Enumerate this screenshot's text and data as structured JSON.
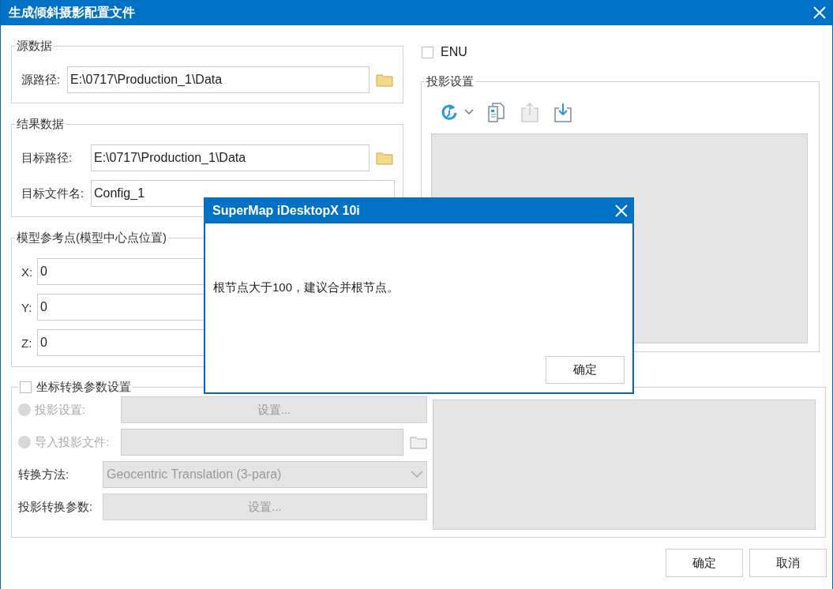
{
  "window": {
    "title": "生成倾斜摄影配置文件"
  },
  "source_group": {
    "title": "源数据",
    "fields": [
      {
        "label": "源路径:",
        "value": "E:\\0717\\Production_1\\Data",
        "browse": true
      }
    ]
  },
  "result_group": {
    "title": "结果数据",
    "fields": [
      {
        "label": "目标路径:",
        "value": "E:\\0717\\Production_1\\Data",
        "browse": true
      },
      {
        "label": "目标文件名:",
        "value": "Config_1",
        "browse": false
      }
    ]
  },
  "reference_group": {
    "title": "模型参考点(模型中心点位置)",
    "fields": [
      {
        "label": "X:",
        "value": "0"
      },
      {
        "label": "Y:",
        "value": "0"
      },
      {
        "label": "Z:",
        "value": "0"
      }
    ]
  },
  "enu": {
    "label": "ENU",
    "checked": false
  },
  "projection_group": {
    "title": "投影设置",
    "toolbar": [
      {
        "kind": "refresh",
        "disabled": false
      },
      {
        "kind": "copy",
        "disabled": false
      },
      {
        "kind": "export",
        "disabled": true
      },
      {
        "kind": "import",
        "disabled": false
      }
    ]
  },
  "transform_group": {
    "title": "坐标转换参数设置",
    "checked": false,
    "rows": [
      {
        "kind": "radio",
        "label": "投影设置:",
        "selected": false,
        "button": "设置..."
      },
      {
        "kind": "file",
        "label": "导入投影文件:",
        "selected": false
      },
      {
        "kind": "select",
        "label": "转换方法:",
        "value": "Geocentric Translation (3-para)"
      },
      {
        "kind": "button",
        "label": "投影转换参数:",
        "button": "设置..."
      }
    ]
  },
  "buttons": [
    "确定",
    "取消"
  ],
  "dialog": {
    "title": "SuperMap iDesktopX 10i",
    "message": "根节点大于100，建议合并根节点。",
    "button": "确定"
  }
}
